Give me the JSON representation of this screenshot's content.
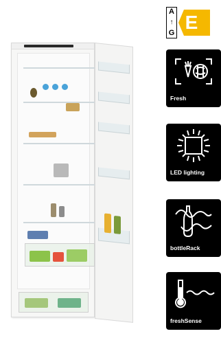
{
  "energy_label": {
    "scale_top": "A",
    "scale_arrow": "↑",
    "scale_bottom": "G",
    "rating": "E",
    "rating_color": "#f5b800"
  },
  "features": [
    {
      "label": "Fresh",
      "icon": "fresh-icon"
    },
    {
      "label": "LED lighting",
      "icon": "led-lighting-icon"
    },
    {
      "label": "bottleRack",
      "icon": "bottle-rack-icon"
    },
    {
      "label": "freshSense",
      "icon": "fresh-sense-icon"
    }
  ],
  "colors": {
    "card_background": "#000000",
    "card_text": "#ffffff"
  }
}
